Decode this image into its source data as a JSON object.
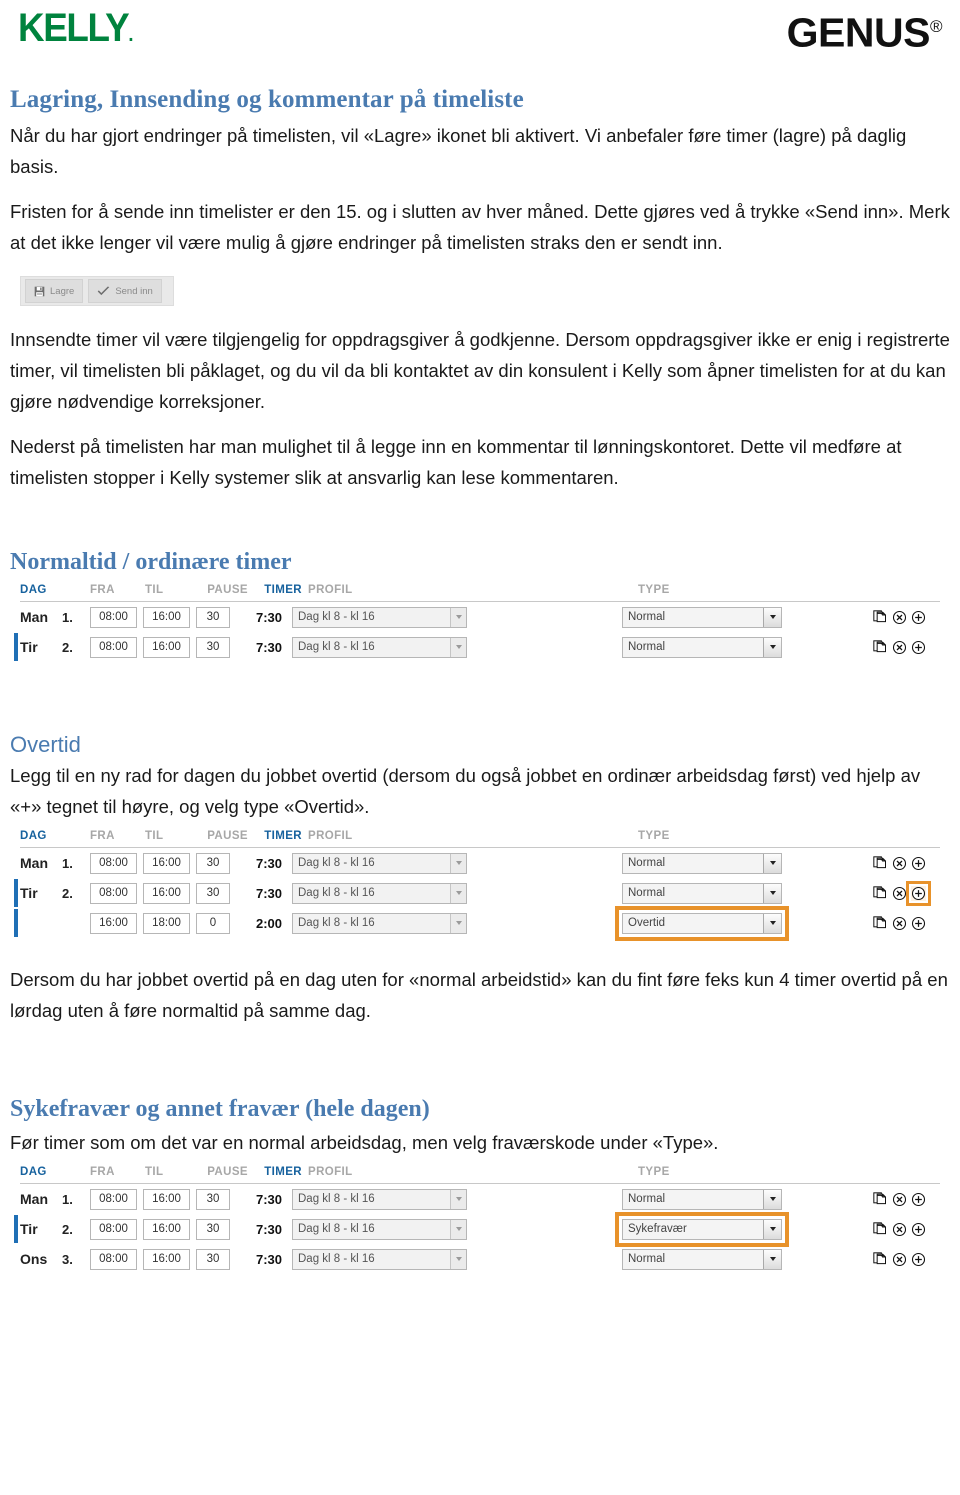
{
  "header": {
    "kelly_logo": "KELLY",
    "kelly_dot": ".",
    "genus_logo": "GENUS",
    "genus_reg": "®"
  },
  "doc": {
    "title": "Lagring, Innsending og kommentar på timeliste",
    "para1": "Når du har gjort endringer på timelisten, vil «Lagre» ikonet bli aktivert. Vi anbefaler føre timer (lagre) på daglig basis.",
    "para2": "Fristen for å sende inn timelister er den 15. og i slutten av hver måned. Dette gjøres ved å trykke «Send inn». Merk at det ikke lenger vil være mulig å gjøre endringer på timelisten straks den er sendt inn.",
    "para3": "Innsendte timer vil være tilgjengelig for oppdragsgiver å godkjenne. Dersom oppdragsgiver ikke er enig i registrerte timer, vil timelisten bli påklaget, og du vil da bli kontaktet av din konsulent i Kelly som åpner timelisten for at du kan gjøre nødvendige korreksjoner.",
    "para4": "Nederst på timelisten har man mulighet til å legge inn en kommentar til lønningskontoret. Dette vil medføre at timelisten stopper i Kelly systemer slik at ansvarlig kan lese kommentaren.",
    "section_normaltid_title": "Normaltid / ordinære timer",
    "section_overtid_title": "Overtid",
    "para_overtid": "Legg til en ny rad for dagen du jobbet overtid (dersom du også jobbet en ordinær arbeidsdag først) ved hjelp av «+» tegnet til høyre, og velg type «Overtid».",
    "para_overtid2": "Dersom du har jobbet overtid på en dag uten for «normal arbeidstid» kan du fint føre feks kun 4 timer overtid på en lørdag uten å føre normaltid på samme dag.",
    "section_sykefravaer_title": "Sykefravær og annet fravær (hele dagen)",
    "para_sykefravaer": "Før timer som om det var en normal arbeidsdag, men velg fraværskode under «Type»."
  },
  "toolbar": {
    "save_label": "Lagre",
    "send_label": "Send inn",
    "save_icon": "floppy-disk-icon",
    "send_icon": "checkmark-icon"
  },
  "timesheet_columns": {
    "dag": "DAG",
    "num": "",
    "fra": "FRA",
    "til": "TIL",
    "pause": "PAUSE",
    "timer": "TIMER",
    "profil": "PROFIL",
    "type": "TYPE"
  },
  "tables": {
    "normaltid": {
      "rows": [
        {
          "dag": "Man",
          "num": "1.",
          "fra": "08:00",
          "til": "16:00",
          "pause": "30",
          "timer": "7:30",
          "profil": "Dag kl 8 - kl 16",
          "type": "Normal",
          "selected_day": false,
          "type_highlight": false,
          "plus_highlight": false
        },
        {
          "dag": "Tir",
          "num": "2.",
          "fra": "08:00",
          "til": "16:00",
          "pause": "30",
          "timer": "7:30",
          "profil": "Dag kl 8 - kl 16",
          "type": "Normal",
          "selected_day": true,
          "type_highlight": false,
          "plus_highlight": false
        }
      ]
    },
    "overtid": {
      "rows": [
        {
          "dag": "Man",
          "num": "1.",
          "fra": "08:00",
          "til": "16:00",
          "pause": "30",
          "timer": "7:30",
          "profil": "Dag kl 8 - kl 16",
          "type": "Normal",
          "selected_day": false,
          "type_highlight": false,
          "plus_highlight": false
        },
        {
          "dag": "Tir",
          "num": "2.",
          "fra": "08:00",
          "til": "16:00",
          "pause": "30",
          "timer": "7:30",
          "profil": "Dag kl 8 - kl 16",
          "type": "Normal",
          "selected_day": true,
          "type_highlight": false,
          "plus_highlight": true
        },
        {
          "dag": "",
          "num": "",
          "fra": "16:00",
          "til": "18:00",
          "pause": "0",
          "timer": "2:00",
          "profil": "Dag kl 8 - kl 16",
          "type": "Overtid",
          "selected_day": true,
          "type_highlight": true,
          "plus_highlight": false
        }
      ]
    },
    "sykefravaer": {
      "rows": [
        {
          "dag": "Man",
          "num": "1.",
          "fra": "08:00",
          "til": "16:00",
          "pause": "30",
          "timer": "7:30",
          "profil": "Dag kl 8 - kl 16",
          "type": "Normal",
          "selected_day": false,
          "type_highlight": false,
          "plus_highlight": false
        },
        {
          "dag": "Tir",
          "num": "2.",
          "fra": "08:00",
          "til": "16:00",
          "pause": "30",
          "timer": "7:30",
          "profil": "Dag kl 8 - kl 16",
          "type": "Sykefravær",
          "selected_day": true,
          "type_highlight": true,
          "plus_highlight": false
        },
        {
          "dag": "Ons",
          "num": "3.",
          "fra": "08:00",
          "til": "16:00",
          "pause": "30",
          "timer": "7:30",
          "profil": "Dag kl 8 - kl 16",
          "type": "Normal",
          "selected_day": false,
          "type_highlight": false,
          "plus_highlight": false
        }
      ]
    }
  },
  "row_actions": {
    "copy_icon": "copy-rows-icon",
    "delete_icon": "delete-circle-icon",
    "add_icon": "add-circle-icon"
  },
  "colors": {
    "heading_blue": "#4a7bb0",
    "kelly_green": "#00833e",
    "highlight_orange": "#e8922a",
    "table_blue": "#17629e",
    "day_marker_blue": "#1f6fb5"
  }
}
